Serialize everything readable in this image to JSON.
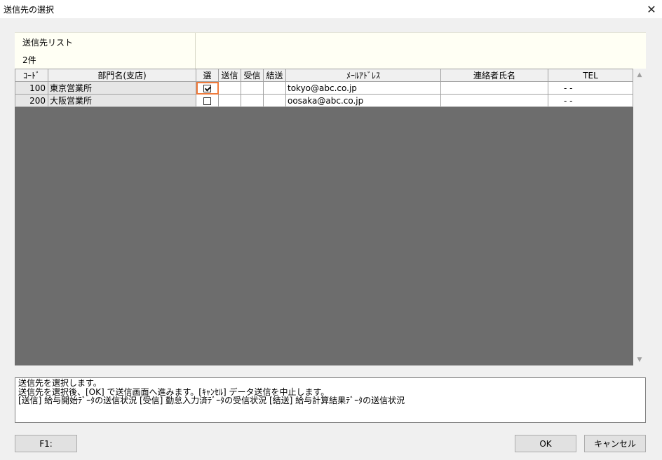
{
  "window": {
    "title": "送信先の選択",
    "close_glyph": "✕"
  },
  "header": {
    "list_label": "送信先リスト",
    "count": "2件"
  },
  "grid": {
    "columns": [
      "ｺｰﾄﾞ",
      "部門名(支店)",
      "選",
      "送信",
      "受信",
      "結送",
      "ﾒｰﾙｱﾄﾞﾚｽ",
      "連絡者氏名",
      "TEL"
    ],
    "rows": [
      {
        "code": "100",
        "dept": "東京営業所",
        "selected": true,
        "send": "",
        "receive": "",
        "ketsuso": "",
        "email": "tokyo@abc.co.jp",
        "contact": "",
        "tel": "-   -"
      },
      {
        "code": "200",
        "dept": "大阪営業所",
        "selected": false,
        "send": "",
        "receive": "",
        "ketsuso": "",
        "email": "oosaka@abc.co.jp",
        "contact": "",
        "tel": "-   -"
      }
    ]
  },
  "scrollbar": {
    "up_glyph": "▲",
    "down_glyph": "▼"
  },
  "message": {
    "lines": [
      "送信先を選択します。",
      "送信先を選択後、[OK] で送信画面へ進みます。[ｷｬﾝｾﾙ] データ送信を中止します。",
      "[送信] 給与開始ﾃﾞｰﾀの送信状況 [受信] 勤怠入力済ﾃﾞｰﾀの受信状況 [結送] 給与計算結果ﾃﾞｰﾀの送信状況"
    ]
  },
  "buttons": {
    "f1": "F1:",
    "ok": "OK",
    "cancel": "キャンセル"
  }
}
